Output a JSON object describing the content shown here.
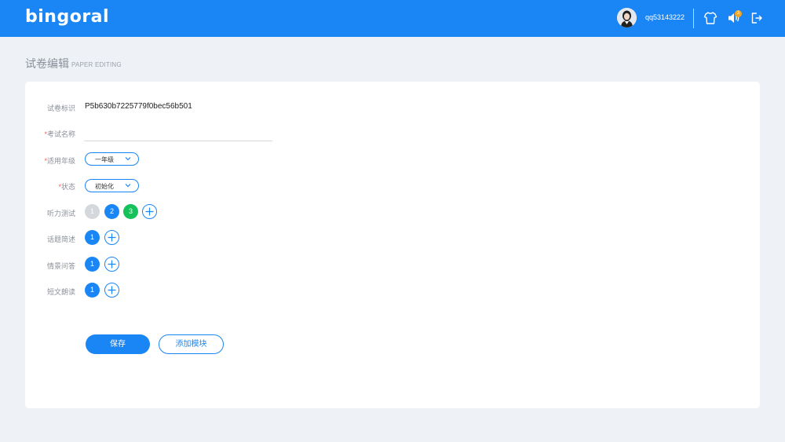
{
  "header": {
    "logo_text": "bingoral",
    "username": "qq53143222",
    "notification_count": "3",
    "brand_color": "#1a86f5"
  },
  "page": {
    "title": "试卷编辑",
    "subtitle": "PAPER EDITING"
  },
  "form": {
    "paper_id": {
      "label": "试卷标识",
      "value": "P5b630b7225779f0bec56b501"
    },
    "exam_name": {
      "required": "*",
      "label": "考试名称",
      "value": "",
      "placeholder": ""
    },
    "grade": {
      "required": "*",
      "label": "适用年级",
      "selected": "一年级"
    },
    "status": {
      "required": "*",
      "label": "状态",
      "selected": "初始化"
    },
    "listening": {
      "label": "听力测试",
      "items": [
        "1",
        "2",
        "3"
      ]
    },
    "topic": {
      "label": "话题简述",
      "items": [
        "1"
      ]
    },
    "scenario": {
      "label": "情景问答",
      "items": [
        "1"
      ]
    },
    "reading": {
      "label": "短文朗读",
      "items": [
        "1"
      ]
    }
  },
  "actions": {
    "save_label": "保存",
    "add_module_label": "添加模块"
  }
}
